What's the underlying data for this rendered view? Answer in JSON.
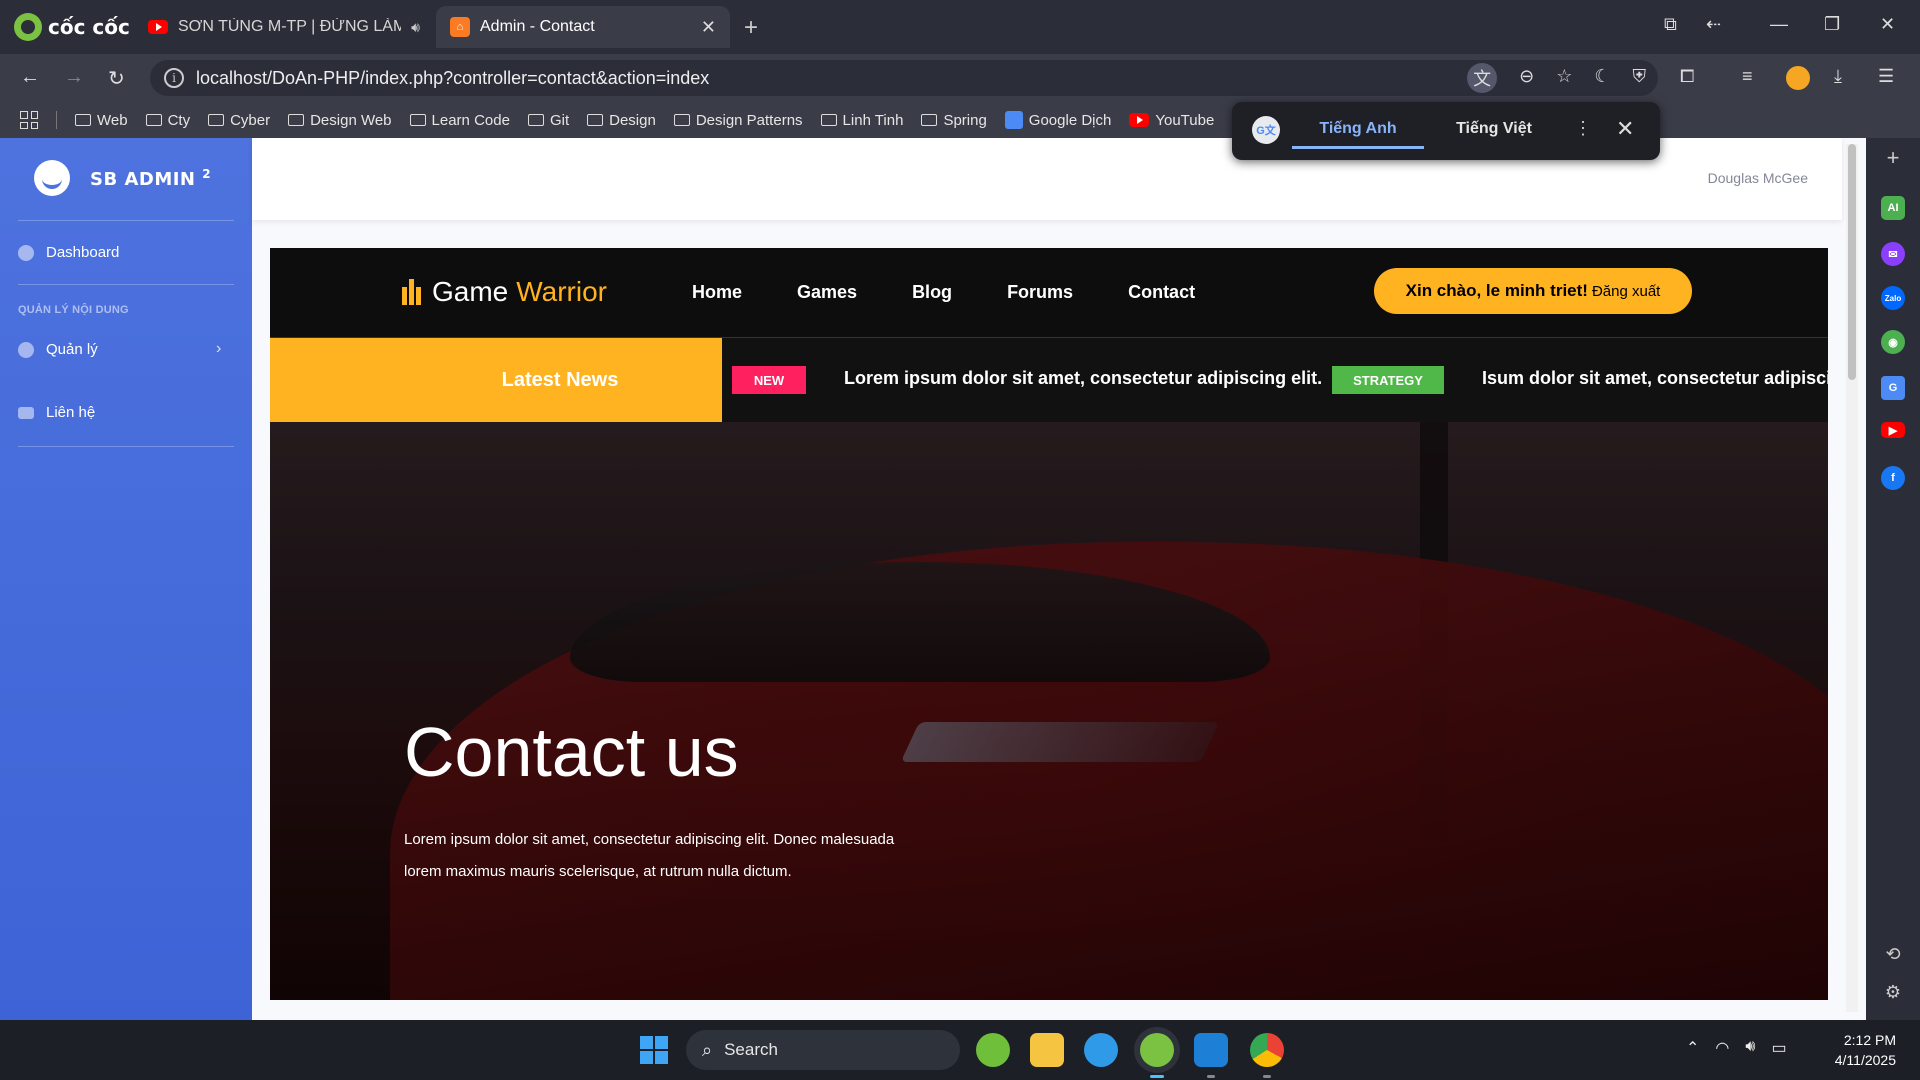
{
  "browser": {
    "brand": "cốc cốc",
    "tabs": [
      {
        "label": "SƠN TÙNG M-TP | ĐỪNG LÀM",
        "icon": "youtube-icon"
      },
      {
        "label": "Admin - Contact",
        "icon": "xampp-icon",
        "active": true
      }
    ],
    "url": "localhost/DoAn-PHP/index.php?controller=contact&action=index",
    "bookmarks": [
      "Web",
      "Cty",
      "Cyber",
      "Design Web",
      "Learn Code",
      "Git",
      "Design",
      "Design Patterns",
      "Linh Tinh",
      "Spring",
      "Google Dịch",
      "YouTube"
    ]
  },
  "translate_popup": {
    "tab_active": "Tiếng Anh",
    "tab_other": "Tiếng Việt"
  },
  "admin": {
    "brand": "SB ADMIN",
    "brand_sup": "2",
    "dashboard": "Dashboard",
    "section_heading": "QUẢN LÝ NỘI DUNG",
    "manage": "Quản lý",
    "contact": "Liên hệ",
    "user": "Douglas McGee"
  },
  "site": {
    "logo_main": "Game",
    "logo_accent": "Warrior",
    "nav": [
      "Home",
      "Games",
      "Blog",
      "Forums",
      "Contact"
    ],
    "greeting": "Xin chào, le minh triet!",
    "logout": "Đăng xuất",
    "news_label": "Latest News",
    "news": [
      {
        "badge": "NEW",
        "text": "Lorem ipsum dolor sit amet, consectetur adipiscing elit."
      },
      {
        "badge": "STRATEGY",
        "text": "Isum dolor sit amet, consectetur adipiscing elit."
      }
    ],
    "hero_title": "Contact us",
    "hero_desc": "Lorem ipsum dolor sit amet, consectetur adipiscing elit. Donec malesuada lorem maximus mauris scelerisque, at rutrum nulla dictum."
  },
  "taskbar": {
    "search": "Search",
    "time": "2:12 PM",
    "date": "4/11/2025"
  },
  "colors": {
    "admin_sidebar": "#4e73df",
    "accent_yellow": "#ffb320",
    "badge_new": "#ff205f",
    "badge_strategy": "#50b848"
  }
}
